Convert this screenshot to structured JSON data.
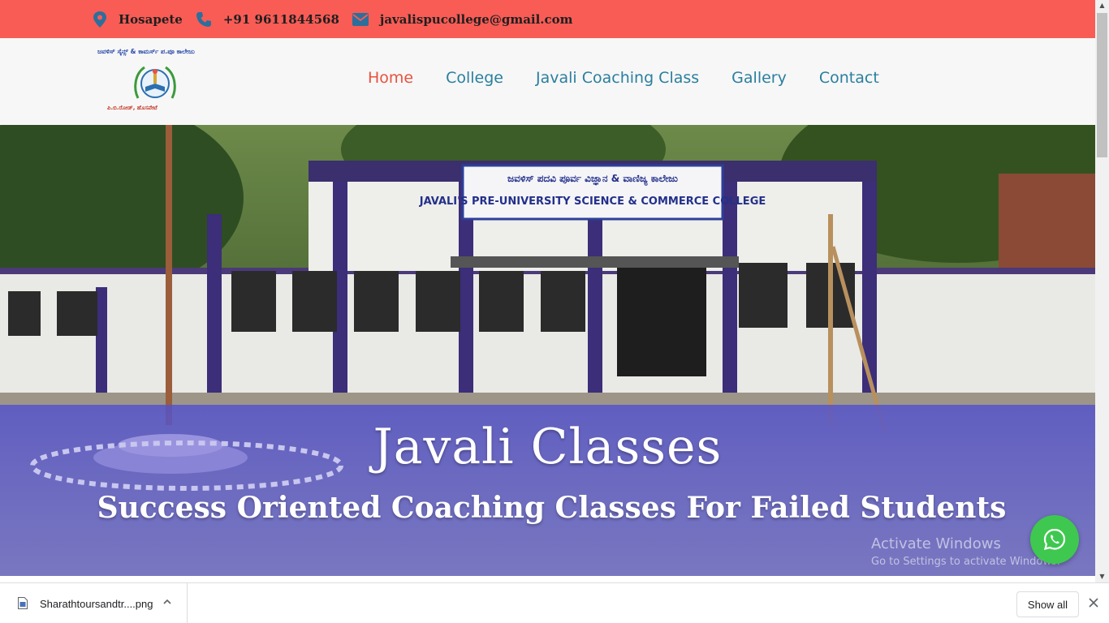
{
  "topbar": {
    "location": "Hosapete",
    "phone": "+91 9611844568",
    "email": "javalispucollege@gmail.com",
    "icons": [
      "map-marker-icon",
      "phone-icon",
      "envelope-icon"
    ],
    "color": "#f85c55"
  },
  "logo": {
    "top_text": "ಜವಳಿಸ್ ಸೈನ್ಸ್ & ಕಾಮರ್ಸ್ ಪ.ಪೂ ಕಾಲೇಜು",
    "bottom_text": "ಪಿ.ಬಿ.ರೋಡ್, ಹೊಸಪೇಟೆ"
  },
  "nav": {
    "items": [
      {
        "label": "Home",
        "active": true
      },
      {
        "label": "College",
        "active": false
      },
      {
        "label": "Javali Coaching Class",
        "active": false
      },
      {
        "label": "Gallery",
        "active": false
      },
      {
        "label": "Contact",
        "active": false
      }
    ],
    "active_color": "#e8523f",
    "link_color": "#2a7f9e"
  },
  "hero": {
    "sign_line1": "ಜವಳಿಸ್ ಪದವಿ ಪೂರ್ವ ವಿಜ್ಞಾನ & ವಾಣಿಜ್ಯ ಕಾಲೇಜು",
    "sign_line2": "JAVALI'S PRE-UNIVERSITY SCIENCE & COMMERCE COLLEGE",
    "title": "Javali Classes",
    "subtitle": "Success Oriented Coaching Classes For Failed Students",
    "overlay_color": "#5a5ad0"
  },
  "watermark": {
    "line1": "Activate Windows",
    "line2": "Go to Settings to activate Windows."
  },
  "whatsapp": {
    "icon": "whatsapp-icon",
    "color": "#3ec84f"
  },
  "downloads": {
    "file_name": "Sharathtoursandtr....png",
    "show_all": "Show all"
  }
}
